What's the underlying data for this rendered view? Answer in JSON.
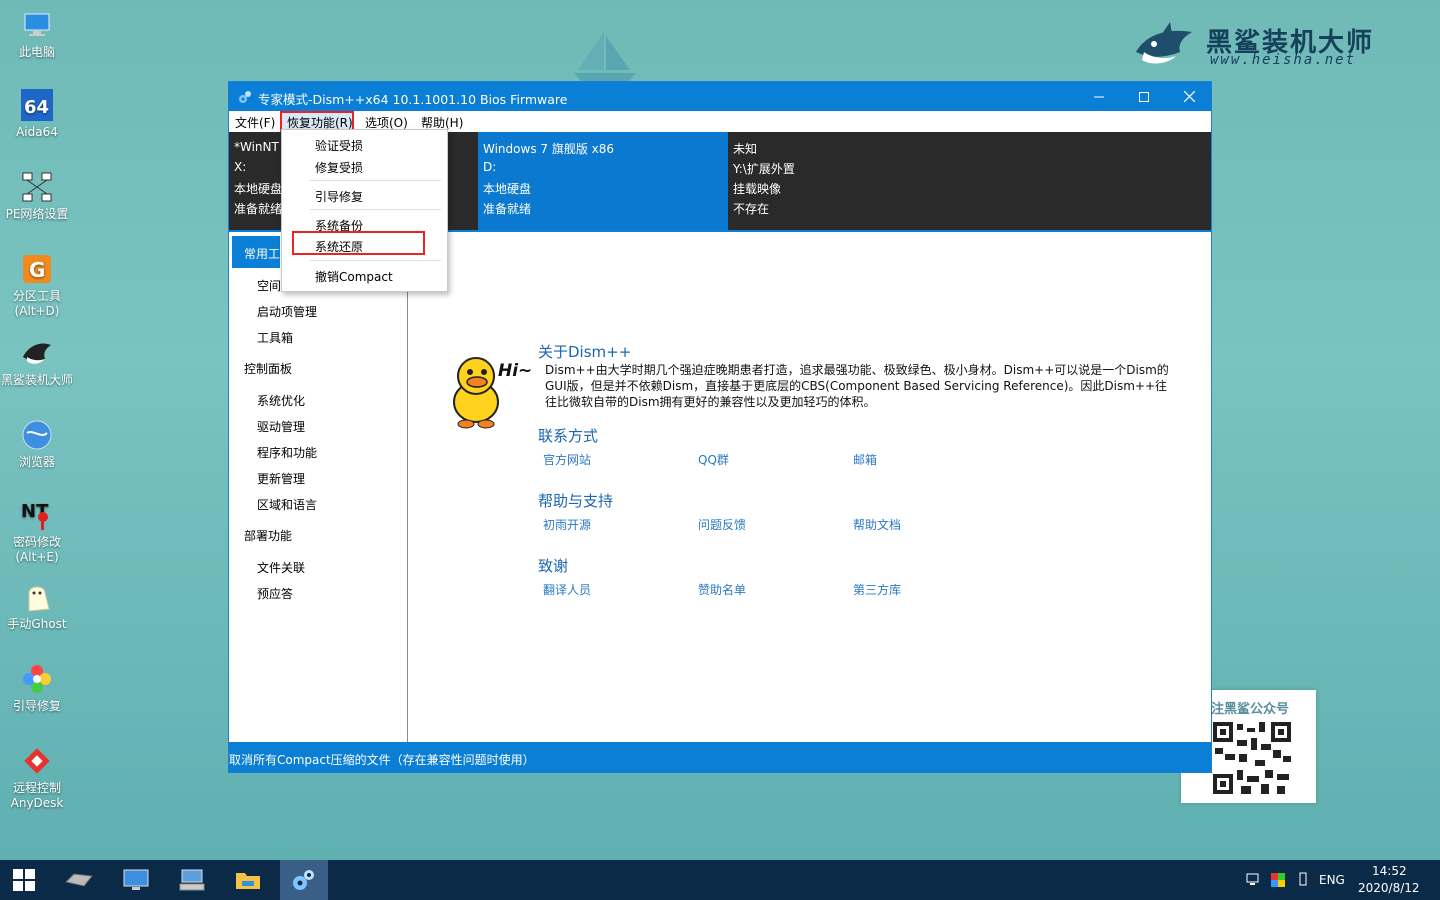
{
  "brand": {
    "title": "黑鲨装机大师",
    "url": "www.heisha.net"
  },
  "desktop_icons": [
    {
      "label": "此电脑",
      "icon": "computer-icon"
    },
    {
      "label": "Aida64",
      "icon": "aida64-icon"
    },
    {
      "label": "PE网络设置",
      "icon": "network-icon"
    },
    {
      "label": "分区工具\n(Alt+D)",
      "icon": "partition-icon"
    },
    {
      "label": "黑鲨装机大师",
      "icon": "shark-icon"
    },
    {
      "label": "浏览器",
      "icon": "browser-icon"
    },
    {
      "label": "密码修改\n(Alt+E)",
      "icon": "password-icon"
    },
    {
      "label": "手动Ghost",
      "icon": "ghost-icon"
    },
    {
      "label": "引导修复",
      "icon": "boot-repair-icon"
    },
    {
      "label": "远程控制\nAnyDesk",
      "icon": "anydesk-icon"
    }
  ],
  "qr": {
    "title": "注黑鲨公众号"
  },
  "window": {
    "title": "专家模式-Dism++x64 10.1.1001.10 Bios Firmware",
    "menus": [
      "文件(F)",
      "恢复功能(R)",
      "选项(O)",
      "帮助(H)"
    ],
    "disks": [
      {
        "name": "*WinNT",
        "drive": "X:",
        "type": "本地硬盘",
        "state": "准备就绪"
      },
      {
        "name": "Windows 7 旗舰版 x86",
        "drive": "D:",
        "type": "本地硬盘",
        "state": "准备就绪"
      },
      {
        "name": "未知",
        "drive": "Y:\\扩展外置",
        "type": "挂载映像",
        "state": "不存在"
      }
    ],
    "sidebar": {
      "head": "常用工",
      "items": [
        "空间",
        "启动项管理",
        "工具箱"
      ],
      "group2": "控制面板",
      "items2": [
        "系统优化",
        "驱动管理",
        "程序和功能",
        "更新管理",
        "区域和语言"
      ],
      "group3": "部署功能",
      "items3": [
        "文件关联",
        "预应答"
      ]
    },
    "content": {
      "about_title": "关于Dism++",
      "about_text": "Dism++由大学时期几个强迫症晚期患者打造，追求最强功能、极致绿色、极小身材。Dism++可以说是一个Dism的GUI版，但是并不依赖Dism，直接基于更底层的CBS(Component Based Servicing Reference)。因此Dism++往往比微软自带的Dism拥有更好的兼容性以及更加轻巧的体积。",
      "hi": "Hi~",
      "contact_title": "联系方式",
      "contact_links": [
        "官方网站",
        "QQ群",
        "邮箱"
      ],
      "help_title": "帮助与支持",
      "help_links": [
        "初雨开源",
        "问题反馈",
        "帮助文档"
      ],
      "thanks_title": "致谢",
      "thanks_links": [
        "翻译人员",
        "赞助名单",
        "第三方库"
      ]
    },
    "status": "取消所有Compact压缩的文件（存在兼容性问题时使用）"
  },
  "dropdown": {
    "items": [
      "验证受损",
      "修复受损",
      "引导修复",
      "系统备份",
      "系统还原",
      "撤销Compact"
    ]
  },
  "taskbar": {
    "lang": "ENG",
    "time": "14:52",
    "date": "2020/8/12"
  },
  "colors": {
    "accent": "#0a7fd5",
    "highlight": "#e22222",
    "taskbar": "#0b2a48"
  }
}
